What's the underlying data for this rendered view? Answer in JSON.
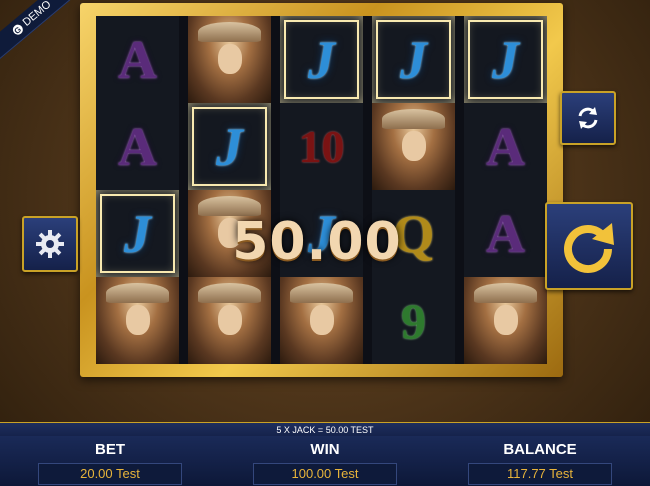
{
  "badge": {
    "label": "DEMO"
  },
  "reels": [
    [
      "A",
      "A",
      "J",
      "portrait"
    ],
    [
      "portrait",
      "J",
      "portrait",
      "portrait"
    ],
    [
      "J",
      "10",
      "J",
      "portrait"
    ],
    [
      "J",
      "portrait",
      "Q",
      "9"
    ],
    [
      "J",
      "A",
      "A",
      "portrait"
    ]
  ],
  "win_amount": "50.00",
  "message": "5 X JACK = 50.00 TEST",
  "stats": {
    "bet": {
      "label": "BET",
      "value": "20.00 Test"
    },
    "win": {
      "label": "WIN",
      "value": "100.00 Test"
    },
    "balance": {
      "label": "BALANCE",
      "value": "117.77 Test"
    }
  },
  "icons": {
    "settings": "gear-icon",
    "autoplay": "autoplay-cycle-icon",
    "spin": "spin-arrow-icon"
  },
  "colors": {
    "frame_gold": "#e0b43a",
    "panel_navy": "#1a2a58",
    "value_text": "#e8b43a"
  }
}
